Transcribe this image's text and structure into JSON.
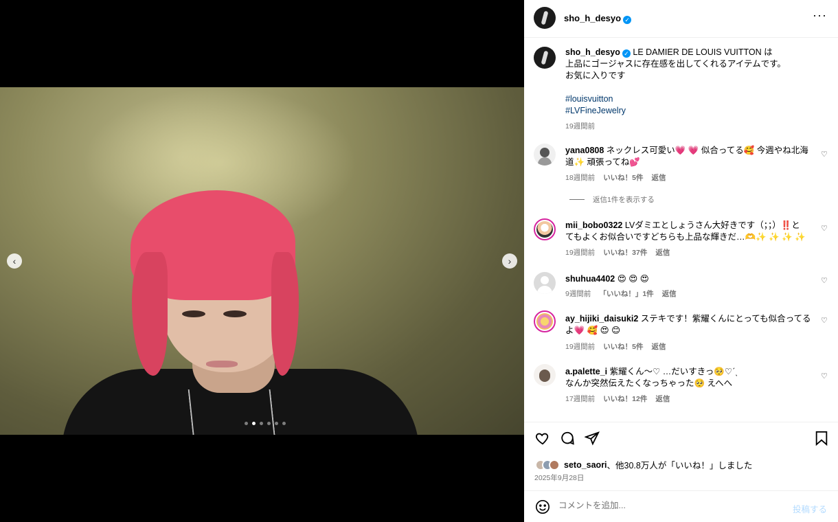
{
  "post": {
    "username": "sho_h_desyo",
    "more_icon": "more-horizontal-icon",
    "caption_line1": "LE DAMIER DE LOUIS VUITTON は",
    "caption_line2": "上品にゴージャスに存在感を出してくれるアイテムです。",
    "caption_line3": "お気に入りです",
    "hashtags": [
      "#louisvuitton",
      "#LVFineJewelry"
    ],
    "caption_time": "19週間前",
    "carousel_index": 2,
    "carousel_total": 6
  },
  "comments": [
    {
      "username": "yana0808",
      "text_line1": "ネックレス可愛い💗 💗 似合ってる🥰 今週やね北海",
      "text_line2": "道✨ 頑張ってね💕",
      "time": "18週間前",
      "likes": "いいね！5件",
      "reply": "返信",
      "view_replies": "返信1件を表示する"
    },
    {
      "username": "mii_bobo0322",
      "text_line1": "LVダミエとしょうさん大好きです（；；）‼️と",
      "text_line2": "てもよくお似合いですどちらも上品な輝きだ…🫶✨ ✨ ✨ ✨",
      "time": "19週間前",
      "likes": "いいね！37件",
      "reply": "返信"
    },
    {
      "username": "shuhua4402",
      "text_line1": "😍 😍 😍",
      "time": "9週間前",
      "likes": "「いいね！」1件",
      "reply": "返信"
    },
    {
      "username": "ay_hijiki_daisuki2",
      "text_line1": "ステキです！紫耀くんにとっても似合ってる",
      "text_line2": "よ💗 🥰 😍 😊",
      "time": "19週間前",
      "likes": "いいね！5件",
      "reply": "返信"
    },
    {
      "username": "a.palette_i",
      "text_line1": "紫耀くん〜♡ …だいすきっ🥺♡ˊˎ",
      "text_line2": "なんか突然伝えたくなっちゃった🥺 えへへ",
      "time": "17週間前",
      "likes": "いいね！12件",
      "reply": "返信"
    }
  ],
  "likes_summary": {
    "user": "seto_saori",
    "text": "、他30.8万人が「いいね！」しました"
  },
  "post_date": "2025年9月28日",
  "comment_box": {
    "placeholder": "コメントを追加...",
    "post_label": "投稿する"
  },
  "colors": {
    "accent_blue": "#0095f6",
    "hashtag": "#00376b",
    "muted": "#737373",
    "hair_pink": "#e84d6b"
  },
  "icons": [
    "heart-icon",
    "comment-icon",
    "share-icon",
    "bookmark-icon",
    "emoji-icon",
    "chevron-left-icon",
    "chevron-right-icon",
    "verified-badge-icon"
  ]
}
